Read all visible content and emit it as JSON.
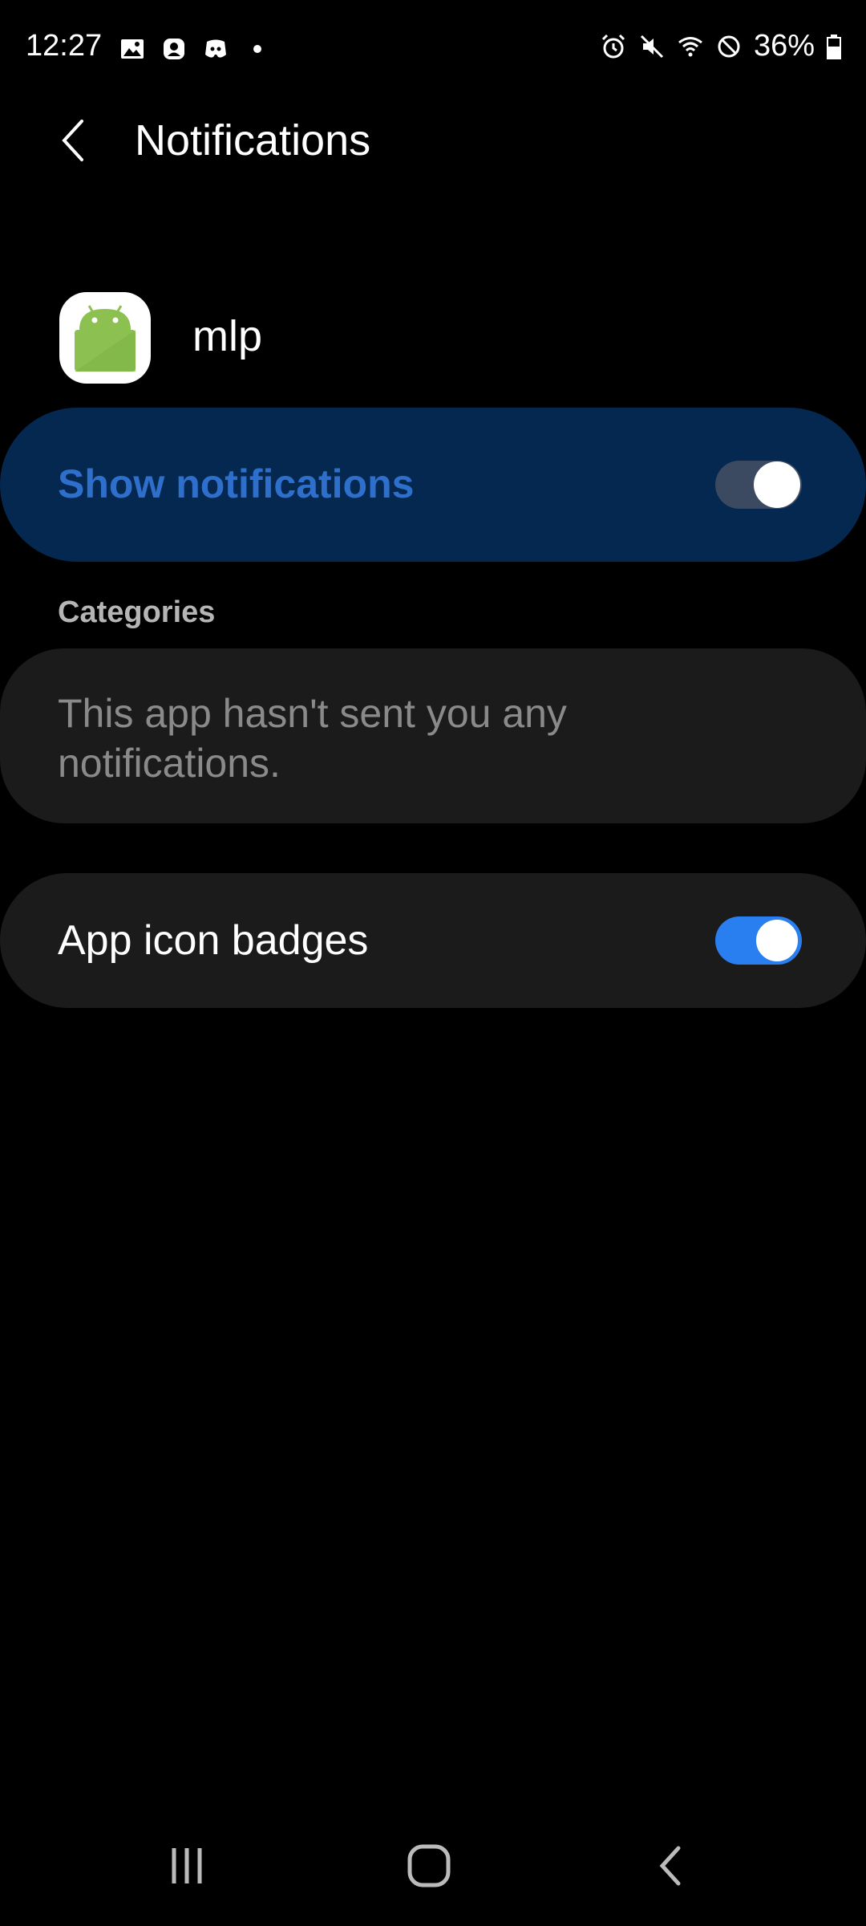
{
  "status_bar": {
    "time": "12:27",
    "battery_percent": "36%",
    "left_icons": [
      "gallery-icon",
      "profile-icon",
      "discord-icon",
      "dot-icon"
    ],
    "right_icons": [
      "alarm-icon",
      "mute-icon",
      "wifi-icon",
      "do-not-disturb-icon",
      "battery-icon"
    ]
  },
  "header": {
    "title": "Notifications",
    "back_icon": "back-icon"
  },
  "app": {
    "name": "mlp",
    "icon": "android-app-icon"
  },
  "show_notifications": {
    "label": "Show notifications",
    "enabled": true
  },
  "categories": {
    "label": "Categories",
    "empty_message": "This app hasn't sent you any notifications."
  },
  "app_icon_badges": {
    "label": "App icon badges",
    "enabled": true
  },
  "nav_bar": {
    "buttons": [
      "recent-apps-icon",
      "home-icon",
      "back-nav-icon"
    ]
  },
  "colors": {
    "background": "#000000",
    "highlight_card": "#04284f",
    "highlight_text": "#2f6fcc",
    "card": "#1b1b1b",
    "toggle_on": "#2a7ff0"
  }
}
